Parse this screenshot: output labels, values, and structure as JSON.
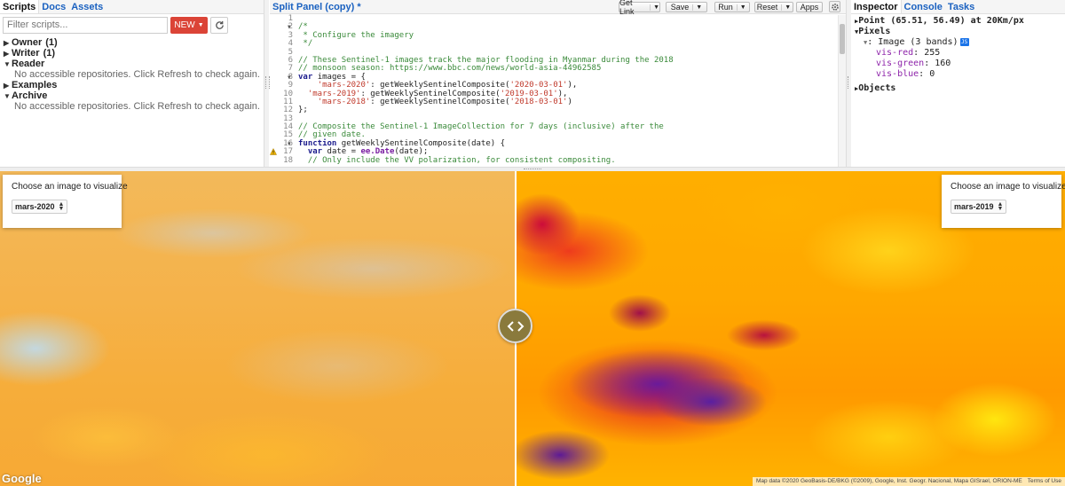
{
  "left_panel": {
    "tabs": [
      "Scripts",
      "Docs",
      "Assets"
    ],
    "filter_placeholder": "Filter scripts...",
    "new_label": "NEW",
    "tree": [
      {
        "label": "Owner",
        "count": "(1)",
        "expanded": false
      },
      {
        "label": "Writer",
        "count": "(1)",
        "expanded": false
      },
      {
        "label": "Reader",
        "count": "",
        "expanded": true,
        "message": "No accessible repositories. Click Refresh to check again."
      },
      {
        "label": "Examples",
        "count": "",
        "expanded": false
      },
      {
        "label": "Archive",
        "count": "",
        "expanded": true,
        "message": "No accessible repositories. Click Refresh to check again."
      }
    ]
  },
  "editor": {
    "title": "Split Panel (copy) *",
    "buttons": {
      "get_link": "Get Link",
      "save": "Save",
      "run": "Run",
      "reset": "Reset",
      "apps": "Apps"
    },
    "lines": [
      {
        "n": "1",
        "t": "",
        "cls": ""
      },
      {
        "n": "2",
        "t": "/*",
        "cls": "c-comment",
        "fold": true
      },
      {
        "n": "3",
        "t": " * Configure the imagery",
        "cls": "c-comment"
      },
      {
        "n": "4",
        "t": " */",
        "cls": "c-comment"
      },
      {
        "n": "5",
        "t": "",
        "cls": ""
      },
      {
        "n": "6",
        "t": "// These Sentinel-1 images track the major flooding in Myanmar during the 2018",
        "cls": "c-comment"
      },
      {
        "n": "7",
        "t": "// monsoon season: https://www.bbc.com/news/world-asia-44962585",
        "cls": "c-comment"
      },
      {
        "n": "8",
        "t": "",
        "cls": "",
        "fold": true,
        "parts": [
          [
            "var ",
            "c-kw"
          ],
          [
            "images = {",
            ""
          ]
        ]
      },
      {
        "n": "9",
        "t": "",
        "cls": "",
        "parts": [
          [
            "    ",
            ""
          ],
          [
            "'mars-2020'",
            "c-str"
          ],
          [
            ": getWeeklySentinelComposite(",
            ""
          ],
          [
            "'2020-03-01'",
            "c-str"
          ],
          [
            "),",
            ""
          ]
        ]
      },
      {
        "n": "10",
        "t": "",
        "cls": "",
        "parts": [
          [
            "  ",
            ""
          ],
          [
            "'mars-2019'",
            "c-str"
          ],
          [
            ": getWeeklySentinelComposite(",
            ""
          ],
          [
            "'2019-03-01'",
            "c-str"
          ],
          [
            "),",
            ""
          ]
        ]
      },
      {
        "n": "11",
        "t": "",
        "cls": "",
        "parts": [
          [
            "    ",
            ""
          ],
          [
            "'mars-2018'",
            "c-str"
          ],
          [
            ": getWeeklySentinelComposite(",
            ""
          ],
          [
            "'2018-03-01'",
            "c-str"
          ],
          [
            ")",
            ""
          ]
        ]
      },
      {
        "n": "12",
        "t": "};",
        "cls": ""
      },
      {
        "n": "13",
        "t": "",
        "cls": ""
      },
      {
        "n": "14",
        "t": "// Composite the Sentinel-1 ImageCollection for 7 days (inclusive) after the",
        "cls": "c-comment"
      },
      {
        "n": "15",
        "t": "// given date.",
        "cls": "c-comment"
      },
      {
        "n": "16",
        "t": "",
        "cls": "",
        "fold": true,
        "parts": [
          [
            "function ",
            "c-kw"
          ],
          [
            "getWeeklySentinelComposite(date) {",
            ""
          ]
        ]
      },
      {
        "n": "17",
        "t": "",
        "cls": "",
        "warn": true,
        "parts": [
          [
            "  ",
            ""
          ],
          [
            "var ",
            "c-kw"
          ],
          [
            "date = ",
            ""
          ],
          [
            "ee.Date",
            "c-ee"
          ],
          [
            "(date);",
            ""
          ]
        ]
      },
      {
        "n": "18",
        "t": "  // Only include the VV polarization, for consistent compositing.",
        "cls": "c-comment"
      }
    ]
  },
  "right_panel": {
    "tabs": [
      "Inspector",
      "Console",
      "Tasks"
    ],
    "point": "Point (65.51, 56.49) at 20Km/px",
    "pixels_label": "Pixels",
    "image_label": ": Image (3 bands)",
    "bands": [
      {
        "key": "vis-red",
        "value": "255"
      },
      {
        "key": "vis-green",
        "value": "160"
      },
      {
        "key": "vis-blue",
        "value": "0"
      }
    ],
    "objects_label": "Objects"
  },
  "map": {
    "left_card": {
      "label": "Choose an image to visualize",
      "selected": "mars-2020"
    },
    "right_card": {
      "label": "Choose an image to visualize",
      "selected": "mars-2019"
    },
    "logo": "Google",
    "attribution": "Map data ©2020 GeoBasis-DE/BKG (©2009), Google, Inst. Geogr. Nacional, Mapa GISrael, ORION-ME",
    "scale": "",
    "terms": "Terms of Use"
  },
  "colors": {
    "accent": "#1a61c0",
    "new_button": "#db4437"
  }
}
